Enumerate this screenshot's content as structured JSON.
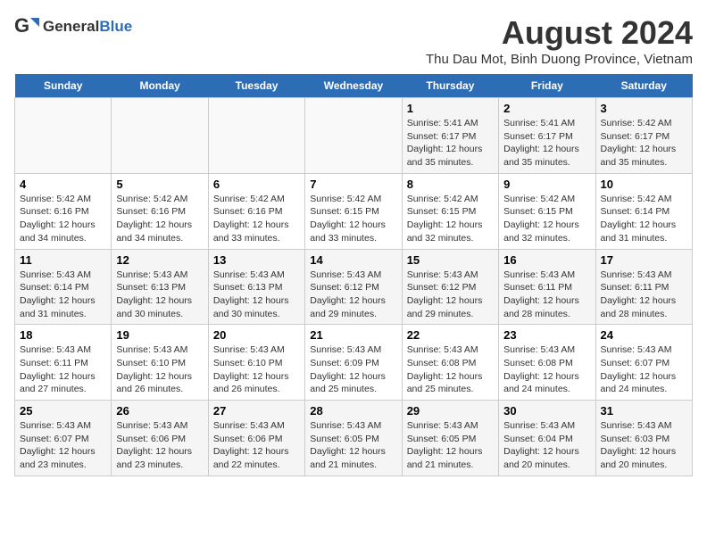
{
  "logo": {
    "text_general": "General",
    "text_blue": "Blue"
  },
  "title": "August 2024",
  "subtitle": "Thu Dau Mot, Binh Duong Province, Vietnam",
  "days_of_week": [
    "Sunday",
    "Monday",
    "Tuesday",
    "Wednesday",
    "Thursday",
    "Friday",
    "Saturday"
  ],
  "weeks": [
    [
      {
        "day": "",
        "info": ""
      },
      {
        "day": "",
        "info": ""
      },
      {
        "day": "",
        "info": ""
      },
      {
        "day": "",
        "info": ""
      },
      {
        "day": "1",
        "info": "Sunrise: 5:41 AM\nSunset: 6:17 PM\nDaylight: 12 hours\nand 35 minutes."
      },
      {
        "day": "2",
        "info": "Sunrise: 5:41 AM\nSunset: 6:17 PM\nDaylight: 12 hours\nand 35 minutes."
      },
      {
        "day": "3",
        "info": "Sunrise: 5:42 AM\nSunset: 6:17 PM\nDaylight: 12 hours\nand 35 minutes."
      }
    ],
    [
      {
        "day": "4",
        "info": "Sunrise: 5:42 AM\nSunset: 6:16 PM\nDaylight: 12 hours\nand 34 minutes."
      },
      {
        "day": "5",
        "info": "Sunrise: 5:42 AM\nSunset: 6:16 PM\nDaylight: 12 hours\nand 34 minutes."
      },
      {
        "day": "6",
        "info": "Sunrise: 5:42 AM\nSunset: 6:16 PM\nDaylight: 12 hours\nand 33 minutes."
      },
      {
        "day": "7",
        "info": "Sunrise: 5:42 AM\nSunset: 6:15 PM\nDaylight: 12 hours\nand 33 minutes."
      },
      {
        "day": "8",
        "info": "Sunrise: 5:42 AM\nSunset: 6:15 PM\nDaylight: 12 hours\nand 32 minutes."
      },
      {
        "day": "9",
        "info": "Sunrise: 5:42 AM\nSunset: 6:15 PM\nDaylight: 12 hours\nand 32 minutes."
      },
      {
        "day": "10",
        "info": "Sunrise: 5:42 AM\nSunset: 6:14 PM\nDaylight: 12 hours\nand 31 minutes."
      }
    ],
    [
      {
        "day": "11",
        "info": "Sunrise: 5:43 AM\nSunset: 6:14 PM\nDaylight: 12 hours\nand 31 minutes."
      },
      {
        "day": "12",
        "info": "Sunrise: 5:43 AM\nSunset: 6:13 PM\nDaylight: 12 hours\nand 30 minutes."
      },
      {
        "day": "13",
        "info": "Sunrise: 5:43 AM\nSunset: 6:13 PM\nDaylight: 12 hours\nand 30 minutes."
      },
      {
        "day": "14",
        "info": "Sunrise: 5:43 AM\nSunset: 6:12 PM\nDaylight: 12 hours\nand 29 minutes."
      },
      {
        "day": "15",
        "info": "Sunrise: 5:43 AM\nSunset: 6:12 PM\nDaylight: 12 hours\nand 29 minutes."
      },
      {
        "day": "16",
        "info": "Sunrise: 5:43 AM\nSunset: 6:11 PM\nDaylight: 12 hours\nand 28 minutes."
      },
      {
        "day": "17",
        "info": "Sunrise: 5:43 AM\nSunset: 6:11 PM\nDaylight: 12 hours\nand 28 minutes."
      }
    ],
    [
      {
        "day": "18",
        "info": "Sunrise: 5:43 AM\nSunset: 6:11 PM\nDaylight: 12 hours\nand 27 minutes."
      },
      {
        "day": "19",
        "info": "Sunrise: 5:43 AM\nSunset: 6:10 PM\nDaylight: 12 hours\nand 26 minutes."
      },
      {
        "day": "20",
        "info": "Sunrise: 5:43 AM\nSunset: 6:10 PM\nDaylight: 12 hours\nand 26 minutes."
      },
      {
        "day": "21",
        "info": "Sunrise: 5:43 AM\nSunset: 6:09 PM\nDaylight: 12 hours\nand 25 minutes."
      },
      {
        "day": "22",
        "info": "Sunrise: 5:43 AM\nSunset: 6:08 PM\nDaylight: 12 hours\nand 25 minutes."
      },
      {
        "day": "23",
        "info": "Sunrise: 5:43 AM\nSunset: 6:08 PM\nDaylight: 12 hours\nand 24 minutes."
      },
      {
        "day": "24",
        "info": "Sunrise: 5:43 AM\nSunset: 6:07 PM\nDaylight: 12 hours\nand 24 minutes."
      }
    ],
    [
      {
        "day": "25",
        "info": "Sunrise: 5:43 AM\nSunset: 6:07 PM\nDaylight: 12 hours\nand 23 minutes."
      },
      {
        "day": "26",
        "info": "Sunrise: 5:43 AM\nSunset: 6:06 PM\nDaylight: 12 hours\nand 23 minutes."
      },
      {
        "day": "27",
        "info": "Sunrise: 5:43 AM\nSunset: 6:06 PM\nDaylight: 12 hours\nand 22 minutes."
      },
      {
        "day": "28",
        "info": "Sunrise: 5:43 AM\nSunset: 6:05 PM\nDaylight: 12 hours\nand 21 minutes."
      },
      {
        "day": "29",
        "info": "Sunrise: 5:43 AM\nSunset: 6:05 PM\nDaylight: 12 hours\nand 21 minutes."
      },
      {
        "day": "30",
        "info": "Sunrise: 5:43 AM\nSunset: 6:04 PM\nDaylight: 12 hours\nand 20 minutes."
      },
      {
        "day": "31",
        "info": "Sunrise: 5:43 AM\nSunset: 6:03 PM\nDaylight: 12 hours\nand 20 minutes."
      }
    ]
  ]
}
